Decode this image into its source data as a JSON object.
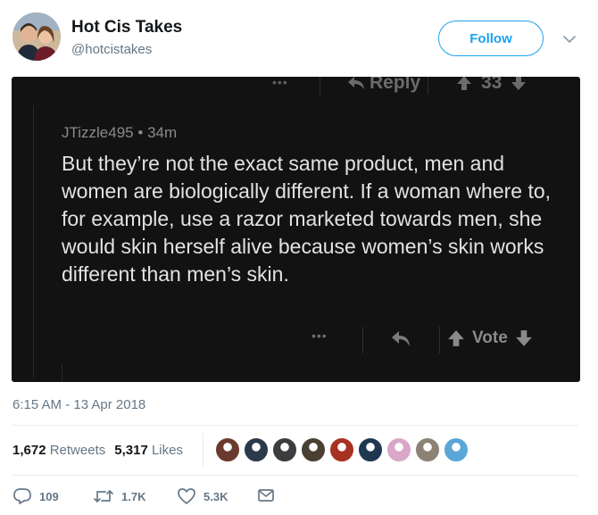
{
  "author": {
    "display_name": "Hot Cis Takes",
    "handle": "@hotcistakes"
  },
  "follow_label": "Follow",
  "embedded_comment": {
    "top_bar": {
      "dots": "•••",
      "reply_label": "Reply",
      "score": "33"
    },
    "username": "JTizzle495",
    "age": "34m",
    "meta_separator": "•",
    "body": "But they’re not the exact same product, men and women are biologically different. If a woman where to, for example, use a razor marketed towards men, she would skin herself alive because women’s skin works different than men’s skin.",
    "bottom_bar": {
      "dots": "•••",
      "vote_label": "Vote"
    }
  },
  "timestamp": "6:15 AM - 13 Apr 2018",
  "stats": {
    "retweets_count": "1,672",
    "retweets_label": "Retweets",
    "likes_count": "5,317",
    "likes_label": "Likes"
  },
  "likers": [
    "#6b3a2e",
    "#2b3a4a",
    "#3d3d3d",
    "#4a4032",
    "#a83222",
    "#1f3850",
    "#d9a7c7",
    "#8c8273",
    "#5aa6d6"
  ],
  "actions": {
    "replies": "109",
    "retweets": "1.7K",
    "likes": "5.3K"
  },
  "colors": {
    "accent": "#1da1f2",
    "secondary_text": "#657786",
    "embedded_bg": "#121212"
  }
}
